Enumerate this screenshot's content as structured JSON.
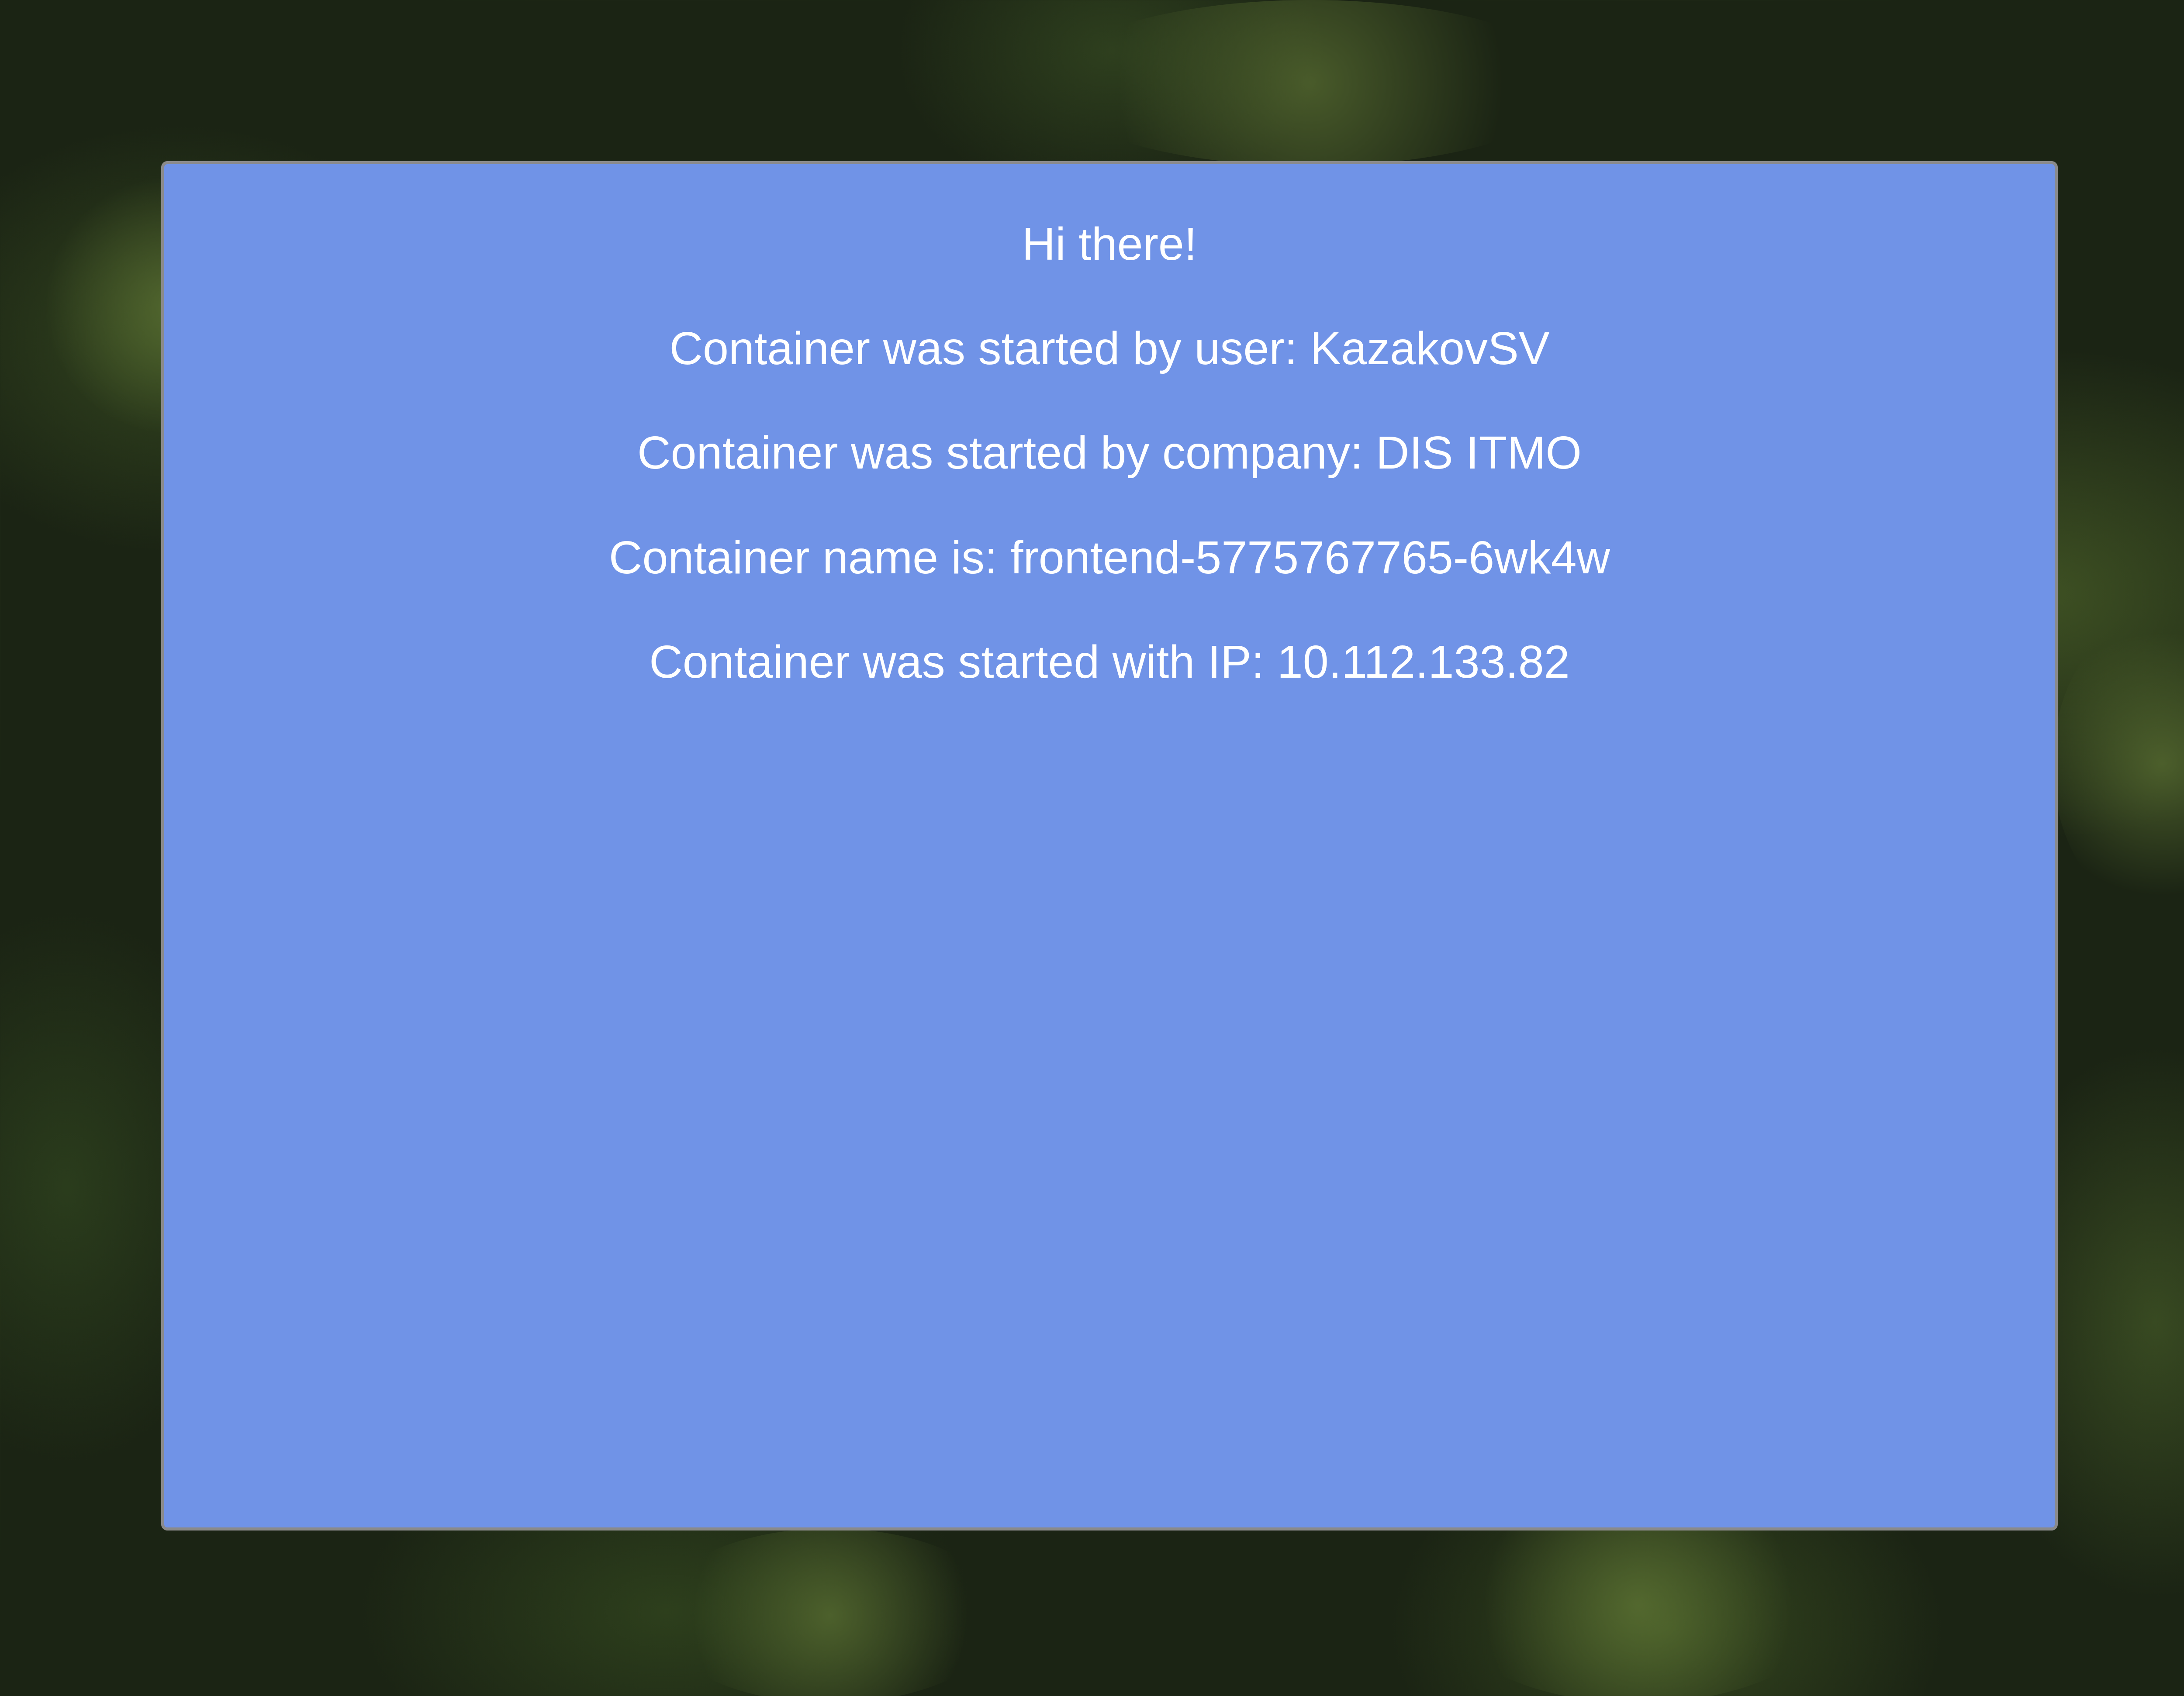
{
  "card": {
    "background_color": "#7093e7",
    "greeting": "Hi there!",
    "user_line": "Container was started by user: KazakovSV",
    "company_line": "Container was started by company: DIS ITMO",
    "name_line": "Container name is: frontend-5775767765-6wk4w",
    "ip_line": "Container was started with IP: 10.112.133.82"
  }
}
